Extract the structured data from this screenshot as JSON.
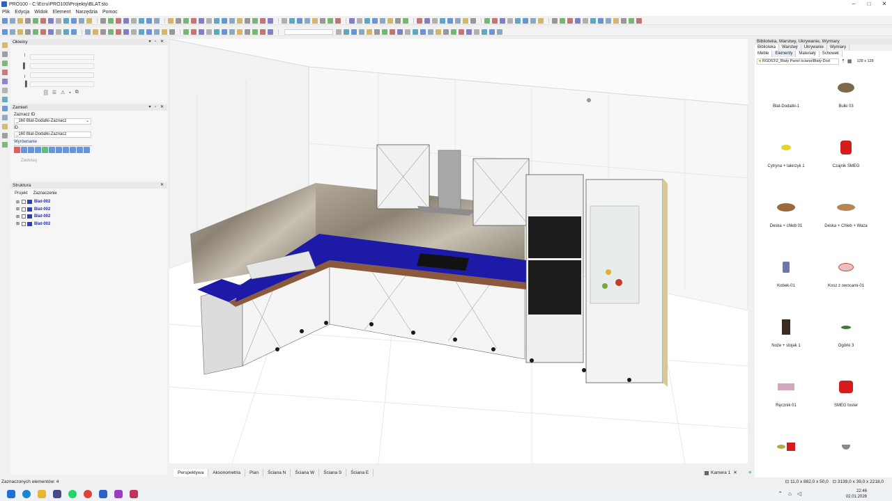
{
  "window": {
    "title": "PRO100 - C:\\Ecru\\PRO100\\Projekty\\BLAT.sto",
    "controls": [
      "–",
      "□",
      "✕"
    ]
  },
  "menu": [
    "Plik",
    "Edycja",
    "Widok",
    "Element",
    "Narzędzia",
    "Pomoc"
  ],
  "panels": {
    "okleiny": {
      "title": "Okleiny"
    },
    "zamien": {
      "title": "Zamień",
      "zaznacz_id_label": "Zaznacz ID",
      "zaznacz_id_value": "_160 Blat-Dodatki-Zaznacz",
      "id_label": "ID",
      "id_value": "_160 Blat-Dodatki-Zaznacz",
      "wyrownanie_label": "Wyrównanie",
      "apply_label": "Zastosuj"
    },
    "struktura": {
      "title": "Struktura",
      "tabs": [
        "Projekt",
        "Zaznaczenie"
      ],
      "items": [
        "Blat-002",
        "Blat-002",
        "Blat-002",
        "Blat-002"
      ]
    }
  },
  "viewport": {
    "tabs": [
      "Perspektywa",
      "Aksonometria",
      "Plan",
      "Ściana N",
      "Ściana W",
      "Ściana S",
      "Ściana E"
    ],
    "active_tab": "Perspektywa",
    "camera": "Kamera 1",
    "add": "+"
  },
  "library": {
    "header": "Biblioteka, Warstwy, Ukrywanie, Wymiary",
    "tabs": [
      "Biblioteka",
      "Warstwy",
      "Ukrywanie",
      "Wymiary"
    ],
    "subtabs": [
      "Meble",
      "Elementy",
      "Materiały",
      "Schowek"
    ],
    "path": "RGD63\\2_Blaty Panel ściana\\Blaty-Dod",
    "thumb_size": "128 x 128",
    "items": [
      {
        "label": "Blat-Dodatki-1"
      },
      {
        "label": "Bulki 03"
      },
      {
        "label": "Cytryna + talerzyk 1"
      },
      {
        "label": "Czajnik SMEG"
      },
      {
        "label": "Deska + chleb 01"
      },
      {
        "label": "Deska + Chleb + Waza"
      },
      {
        "label": "Kobek-01"
      },
      {
        "label": "Kosz z owocami-01"
      },
      {
        "label": "Noże + stojak 1"
      },
      {
        "label": "Ogórki 3"
      },
      {
        "label": "Ręcznik 01"
      },
      {
        "label": "SMEG toster"
      },
      {
        "label": ""
      },
      {
        "label": ""
      }
    ]
  },
  "status": {
    "left": "Zaznaczonych elementów: 4",
    "dims1": "11,0 x 882,0 x 50,0",
    "dims2": "3139,0 x 39,0 x 2218,0"
  },
  "taskbar": {
    "time": "22:46",
    "date": "02.01.2026"
  },
  "colors": {
    "countertop_selected": "#1c1aa6",
    "marble": "#9a9182",
    "oven": "#1c1c1c",
    "accent": "#2a62c9"
  }
}
